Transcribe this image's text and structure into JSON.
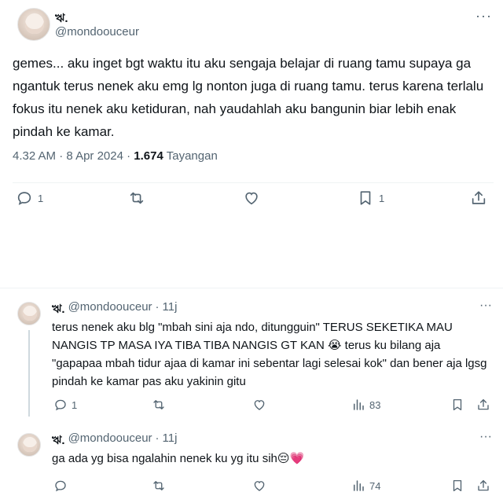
{
  "tweet": {
    "display_name": "ঋ.",
    "handle": "@mondoouceur",
    "text": "gemes... aku inget bgt waktu itu aku sengaja belajar di ruang tamu supaya ga ngantuk terus nenek aku emg lg nonton juga di ruang tamu. terus karena terlalu fokus itu nenek aku ketiduran, nah yaudahlah aku bangunin biar lebih enak pindah ke kamar.",
    "time": "4.32 AM",
    "date": "8 Apr 2024",
    "views_count": "1.674",
    "views_label": "Tayangan",
    "replies": "1",
    "reposts": "",
    "likes": "",
    "bookmarks": "1",
    "more_icon": "···"
  },
  "replies": [
    {
      "display_name": "ঋ.",
      "handle": "@mondoouceur",
      "dot": "·",
      "time": "11j",
      "text": "terus nenek aku blg \"mbah sini aja ndo, ditungguin\" TERUS SEKETIKA MAU NANGIS TP MASA IYA TIBA TIBA NANGIS GT KAN 😭 terus ku bilang aja \"gapapaa mbah tidur ajaa di kamar ini sebentar lagi selesai kok\" dan bener aja lgsg pindah ke kamar pas aku yakinin gitu",
      "replies": "1",
      "views": "83",
      "more_icon": "···"
    },
    {
      "display_name": "ঋ.",
      "handle": "@mondoouceur",
      "dot": "·",
      "time": "11j",
      "text": "ga ada yg bisa ngalahin nenek ku yg itu sih😔💗",
      "replies": "",
      "views": "74",
      "more_icon": "···"
    }
  ],
  "colors": {
    "text": "#0f1419",
    "secondary": "#536471",
    "border": "#eff3f4"
  }
}
